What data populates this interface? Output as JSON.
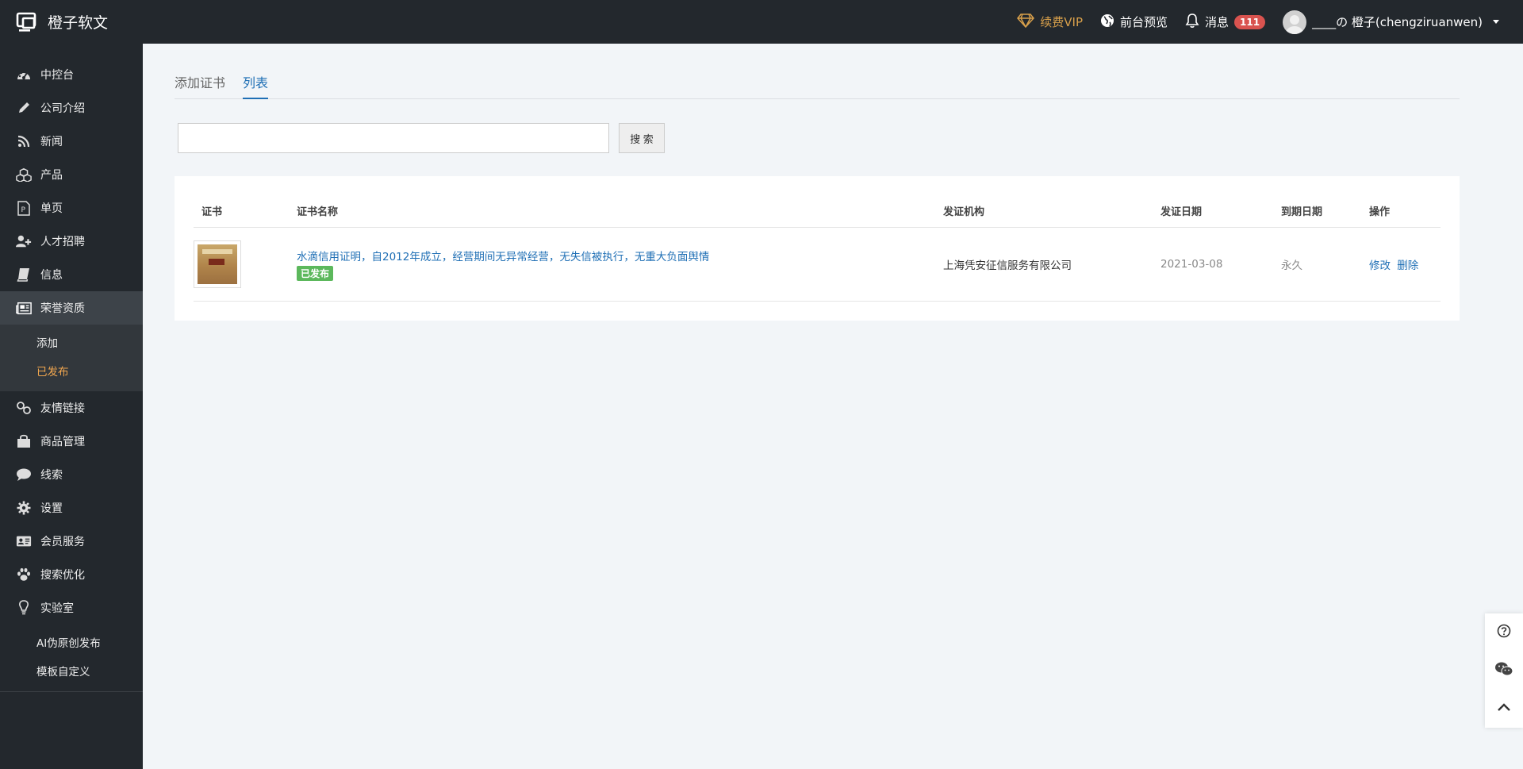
{
  "topbar": {
    "brand": "橙子软文",
    "vip_label": "续费VIP",
    "preview_label": "前台预览",
    "messages_label": "消息",
    "messages_count": "111",
    "user_name": "____の 橙子(chengziruanwen)"
  },
  "sidebar": {
    "items": [
      {
        "label": "中控台",
        "icon": "dashboard-icon"
      },
      {
        "label": "公司介绍",
        "icon": "pencil-icon"
      },
      {
        "label": "新闻",
        "icon": "rss-icon"
      },
      {
        "label": "产品",
        "icon": "cubes-icon"
      },
      {
        "label": "单页",
        "icon": "page-icon"
      },
      {
        "label": "人才招聘",
        "icon": "user-plus-icon"
      },
      {
        "label": "信息",
        "icon": "book-icon"
      },
      {
        "label": "荣誉资质",
        "icon": "newspaper-icon"
      }
    ],
    "honor_sub": [
      {
        "label": "添加"
      },
      {
        "label": "已发布"
      }
    ],
    "items2": [
      {
        "label": "友情链接",
        "icon": "link-icon"
      },
      {
        "label": "商品管理",
        "icon": "shopping-bag-icon"
      },
      {
        "label": "线索",
        "icon": "comment-icon"
      },
      {
        "label": "设置",
        "icon": "gear-icon"
      },
      {
        "label": "会员服务",
        "icon": "id-card-icon"
      },
      {
        "label": "搜索优化",
        "icon": "paw-icon"
      },
      {
        "label": "实验室",
        "icon": "lightbulb-icon"
      }
    ],
    "lab_sub": [
      {
        "label": "AI伪原创发布"
      },
      {
        "label": "模板自定义"
      }
    ]
  },
  "tabs": [
    {
      "label": "添加证书"
    },
    {
      "label": "列表"
    }
  ],
  "search": {
    "value": "",
    "button_label": "搜 索"
  },
  "table": {
    "headers": [
      "证书",
      "证书名称",
      "发证机构",
      "发证日期",
      "到期日期",
      "操作"
    ],
    "rows": [
      {
        "name": "水滴信用证明，自2012年成立，经营期间无异常经营，无失信被执行，无重大负面舆情",
        "status": "已发布",
        "issuer": "上海凭安征信服务有限公司",
        "issue_date": "2021-03-08",
        "expiry": "永久",
        "edit_label": "修改",
        "delete_label": "删除"
      }
    ]
  },
  "colors": {
    "topbar_bg": "#23282d",
    "accent_blue": "#1f6fb5",
    "vip_gold": "#d8a04b",
    "badge_red": "#d9534f",
    "status_green": "#5cb85c",
    "submenu_current": "#f0a64f"
  }
}
